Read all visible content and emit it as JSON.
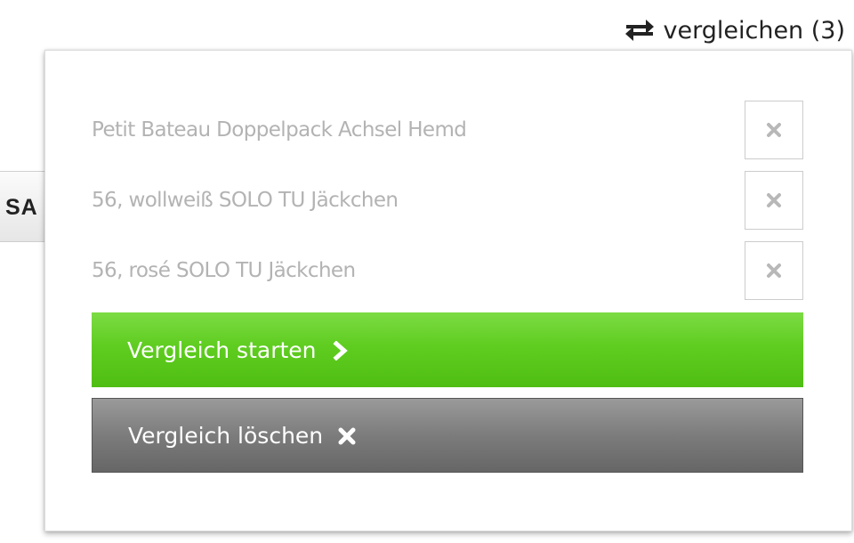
{
  "header": {
    "compare_label": "vergleichen (3)",
    "compare_icon": "swap-arrows-icon"
  },
  "background": {
    "partial_button_label": "SA"
  },
  "compare_popup": {
    "items": [
      {
        "name": "Petit Bateau Doppelpack Achsel Hemd",
        "remove_icon": "close-icon"
      },
      {
        "name": "56, wollweiß SOLO TU Jäckchen",
        "remove_icon": "close-icon"
      },
      {
        "name": "56, rosé SOLO TU Jäckchen",
        "remove_icon": "close-icon"
      }
    ],
    "start_button": {
      "label": "Vergleich starten",
      "icon": "chevron-right-icon",
      "color": "#5fcd20"
    },
    "clear_button": {
      "label": "Vergleich löschen",
      "icon": "close-icon",
      "color": "#7c7c7c"
    }
  }
}
